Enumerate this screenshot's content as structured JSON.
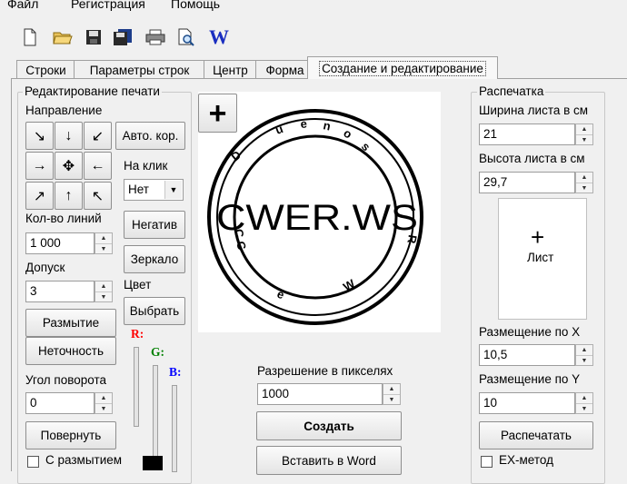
{
  "menu": {
    "file": "Файл",
    "registration": "Регистрация",
    "help": "Помощь"
  },
  "toolbar": {
    "word_icon_letter": "W"
  },
  "tabs": [
    "Строки",
    "Параметры строк",
    "Центр",
    "Форма",
    "Создание и редактирование"
  ],
  "print_edit": {
    "title": "Редактирование печати",
    "direction_label": "Направление",
    "arrows": [
      "↘",
      "↓",
      "↙",
      "→",
      "✥",
      "←",
      "↗",
      "↑",
      "↖"
    ],
    "auto_correct_label": "Авто. кор.",
    "on_click_label": "На клик",
    "on_click_value": "Нет",
    "line_count_label": "Кол-во линий",
    "line_count_value": "1 000",
    "negative_label": "Негатив",
    "tolerance_label": "Допуск",
    "tolerance_value": "3",
    "mirror_label": "Зеркало",
    "color_label": "Цвет",
    "choose_label": "Выбрать",
    "blur_label": "Размытие",
    "inaccuracy_label": "Неточность",
    "r_label": "R:",
    "g_label": "G:",
    "b_label": "B:",
    "angle_label": "Угол поворота",
    "angle_value": "0",
    "rotate_label": "Повернуть",
    "with_blur_label": "С размытием",
    "colors": {
      "r": "#ff0000",
      "g": "#008000",
      "b": "#0000ff",
      "swatch": "#000000"
    }
  },
  "preview": {
    "plus": "+",
    "stamp_center": "CWER.WS",
    "stamp_ring_letters": [
      "D",
      "u",
      "e",
      "n",
      "o",
      "s",
      "R",
      "W",
      "e",
      "C",
      "C"
    ],
    "resolution_label": "Разрешение в пикселях",
    "resolution_value": "1000",
    "create_label": "Создать",
    "insert_word_label": "Вставить в Word"
  },
  "printout": {
    "title": "Распечатка",
    "sheet_width_label": "Ширина листа в см",
    "sheet_width_value": "21",
    "sheet_height_label": "Высота листа в см",
    "sheet_height_value": "29,7",
    "sheet_plus": "+",
    "sheet_label": "Лист",
    "pos_x_label": "Размещение по X",
    "pos_x_value": "10,5",
    "pos_y_label": "Размещение по Y",
    "pos_y_value": "10",
    "print_label": "Распечатать",
    "ex_method_label": "EX-метод"
  }
}
